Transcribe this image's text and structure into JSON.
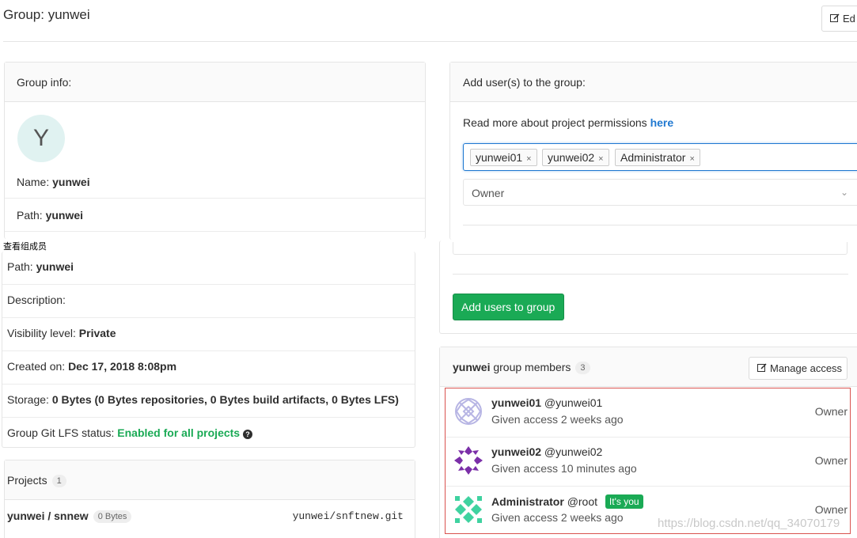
{
  "page": {
    "title": "Group: yunwei",
    "edit_label": "Ed"
  },
  "group_info": {
    "heading": "Group info:",
    "avatar_letter": "Y",
    "name_label": "Name:",
    "name_value": "yunwei",
    "path_label": "Path:",
    "path_value": "yunwei"
  },
  "annotation": "查看组成员",
  "details": {
    "path_label": "Path:",
    "path_value": "yunwei",
    "description_label": "Description:",
    "visibility_label": "Visibility level:",
    "visibility_value": "Private",
    "created_label": "Created on:",
    "created_value": "Dec 17, 2018 8:08pm",
    "storage_label": "Storage:",
    "storage_value": "0 Bytes (0 Bytes repositories, 0 Bytes build artifacts, 0 Bytes LFS)",
    "lfs_label": "Group Git LFS status:",
    "lfs_value": "Enabled for all projects"
  },
  "projects": {
    "heading": "Projects",
    "count": "1",
    "items": [
      {
        "name": "yunwei / snnew",
        "size": "0 Bytes",
        "repo": "yunwei/snftnew.git"
      }
    ]
  },
  "add_users": {
    "heading": "Add user(s) to the group:",
    "perm_text": "Read more about project permissions",
    "perm_link": "here",
    "tokens": [
      "yunwei01",
      "yunwei02",
      "Administrator"
    ],
    "token_remove": "×",
    "role": "Owner",
    "button": "Add users to group"
  },
  "members": {
    "group": "yunwei",
    "title_suffix": "group members",
    "count": "3",
    "manage_label": "Manage access",
    "you_badge": "It's you",
    "items": [
      {
        "name": "yunwei01",
        "handle": "@yunwei01",
        "access": "Given access 2 weeks ago",
        "role": "Owner"
      },
      {
        "name": "yunwei02",
        "handle": "@yunwei02",
        "access": "Given access 10 minutes ago",
        "role": "Owner"
      },
      {
        "name": "Administrator",
        "handle": "@root",
        "access": "Given access 2 weeks ago",
        "role": "Owner"
      }
    ]
  },
  "watermark": "https://blog.csdn.net/qq_34070179",
  "colors": {
    "accent_green": "#1aaa55",
    "link_blue": "#1f78d1",
    "highlight_red": "#d9534f"
  }
}
